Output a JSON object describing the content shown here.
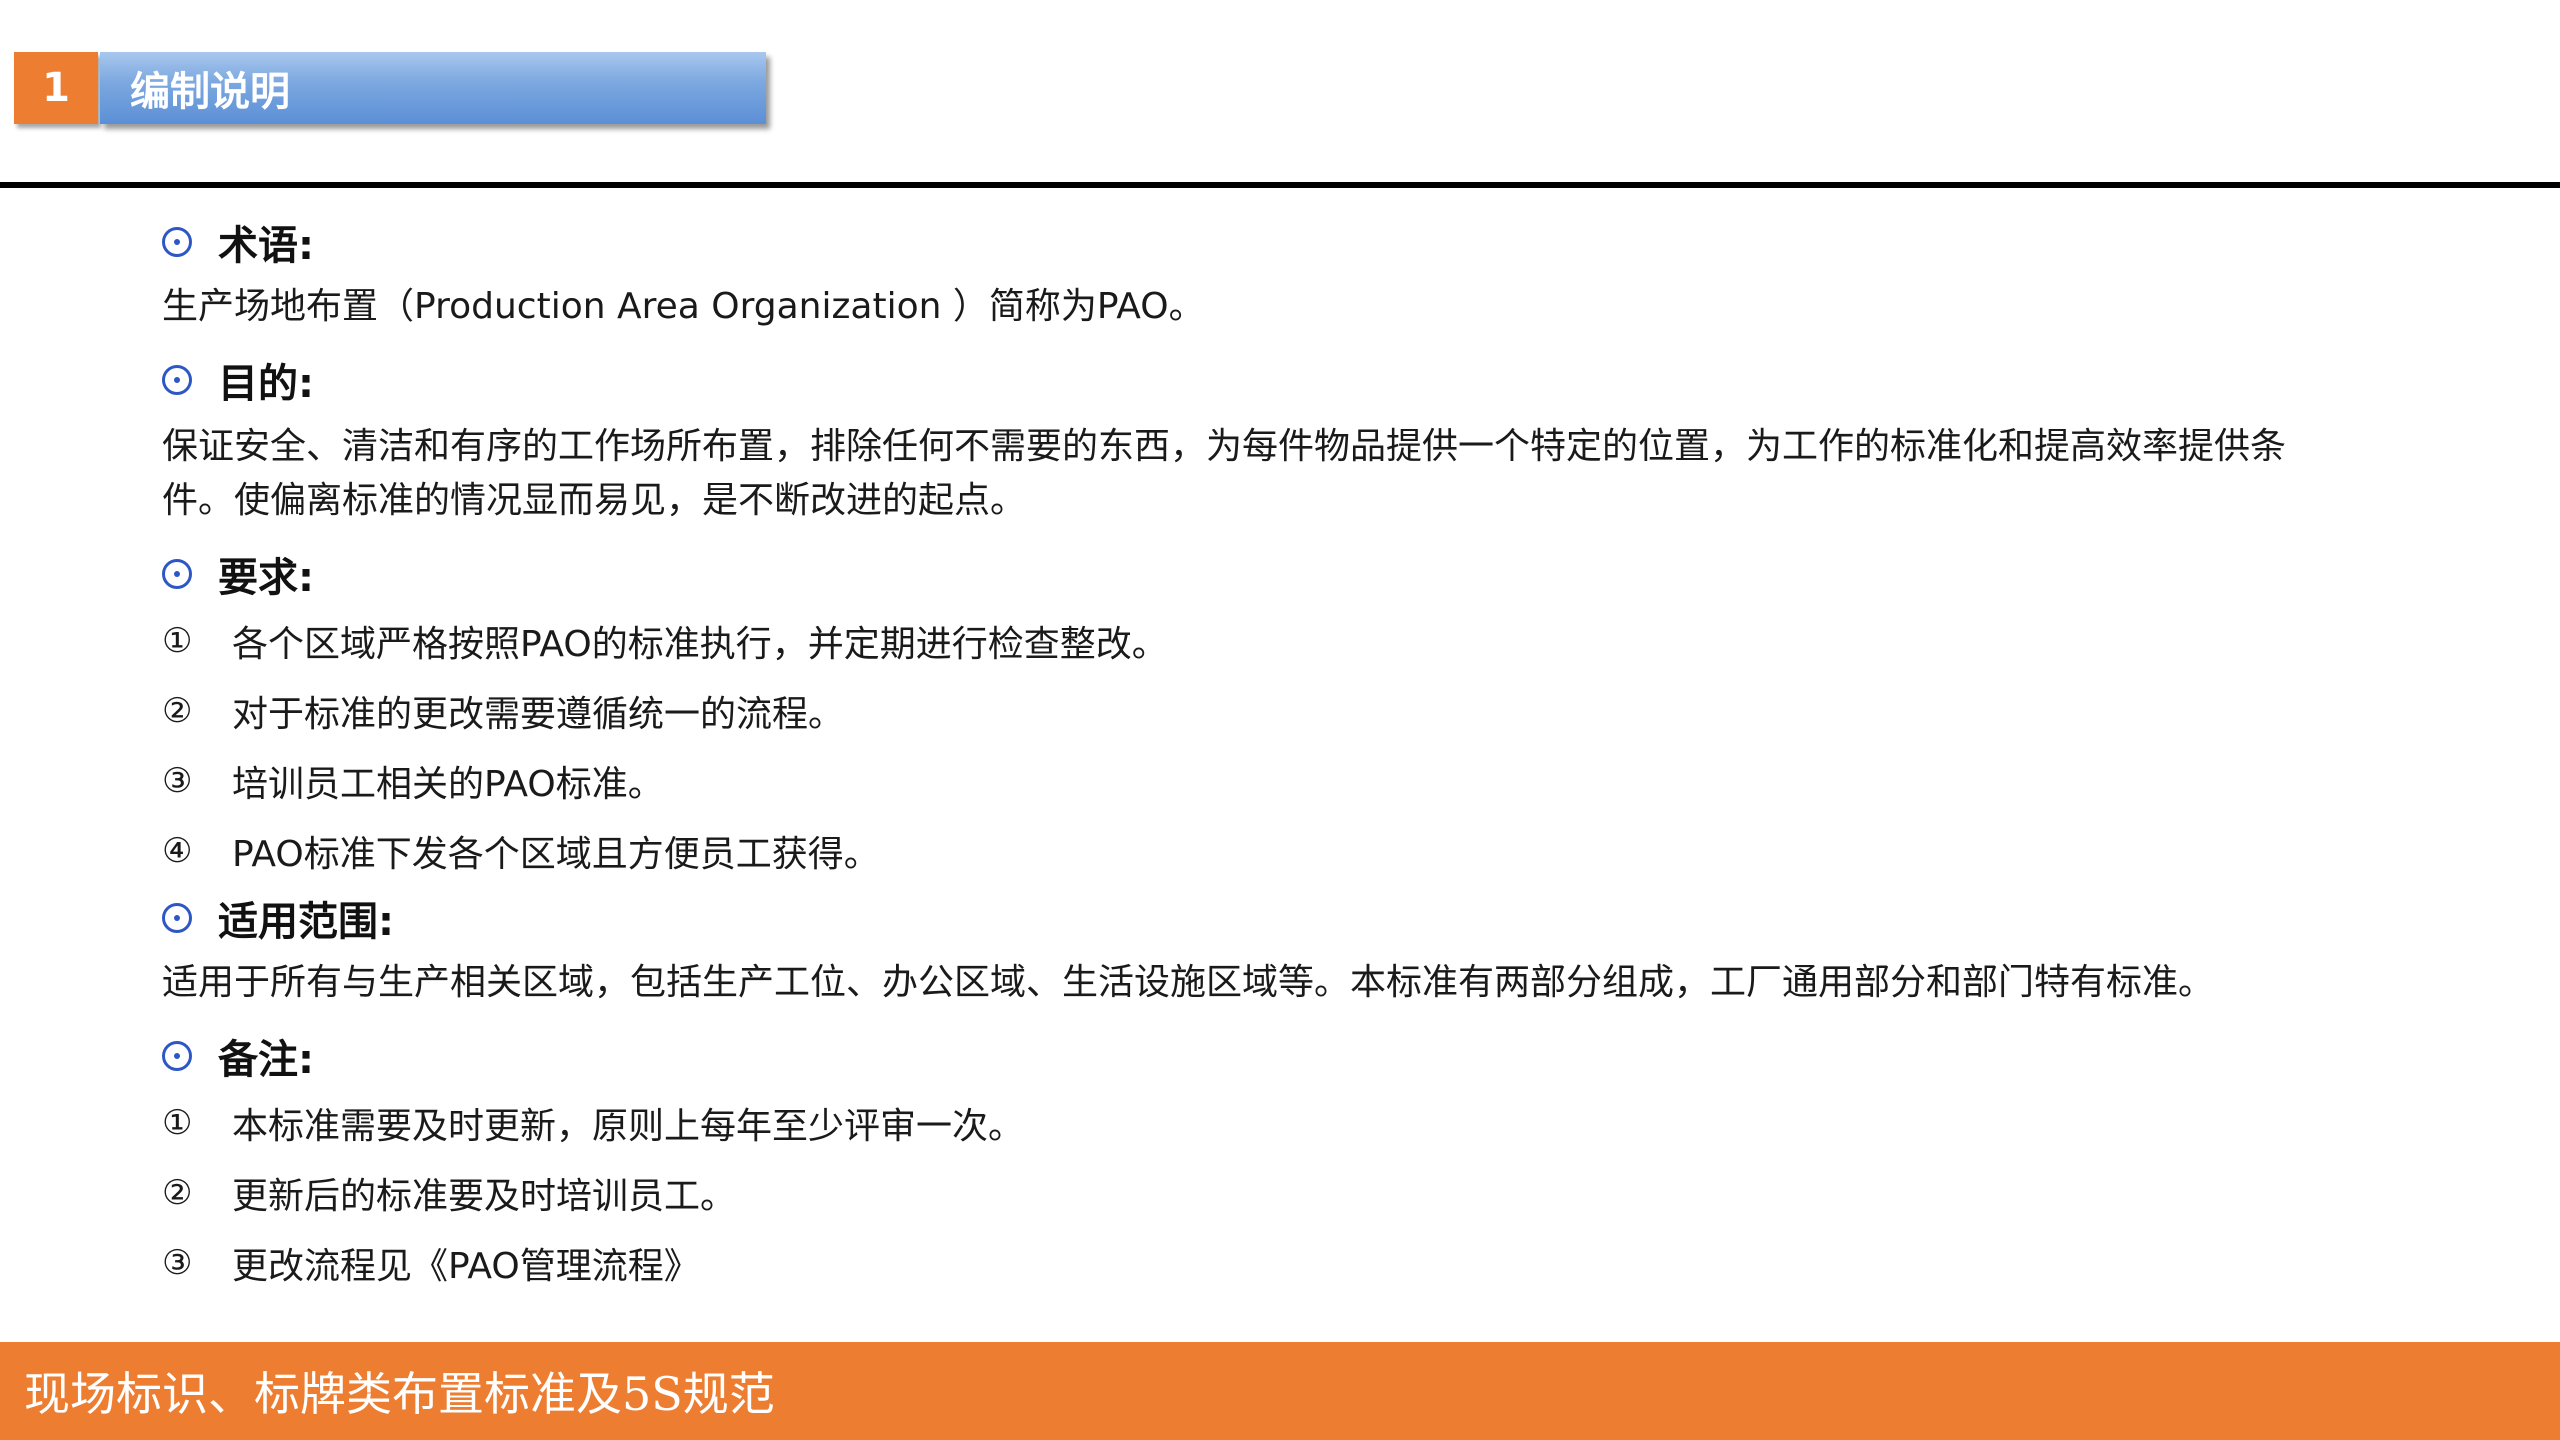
{
  "header": {
    "number": "1",
    "title": "编制说明"
  },
  "sections": {
    "terms": {
      "heading": "术语:",
      "text": "生产场地布置（Production Area Organization ）简称为PAO。"
    },
    "purpose": {
      "heading": "目的:",
      "lines": [
        "保证安全、清洁和有序的工作场所布置，排除任何不需要的东西，为每件物品提供一个特定的位置，为工作的标准化和提高效率提供条",
        "件。使偏离标准的情况显而易见，是不断改进的起点。"
      ]
    },
    "requirements": {
      "heading": "要求:",
      "items": [
        {
          "mark": "①",
          "text": "各个区域严格按照PAO的标准执行，并定期进行检查整改。"
        },
        {
          "mark": "②",
          "text": "对于标准的更改需要遵循统一的流程。"
        },
        {
          "mark": "③",
          "text": "培训员工相关的PAO标准。"
        },
        {
          "mark": "④",
          "text": "PAO标准下发各个区域且方便员工获得。"
        }
      ]
    },
    "scope": {
      "heading": "适用范围:",
      "text": "适用于所有与生产相关区域，包括生产工位、办公区域、生活设施区域等。本标准有两部分组成，工厂通用部分和部门特有标准。"
    },
    "notes": {
      "heading": "备注:",
      "items": [
        {
          "mark": "①",
          "text": "本标准需要及时更新，原则上每年至少评审一次。"
        },
        {
          "mark": "②",
          "text": "更新后的标准要及时培训员工。"
        },
        {
          "mark": "③",
          "text": "更改流程见《PAO管理流程》"
        }
      ]
    }
  },
  "footer": {
    "text": "现场标识、标牌类布置标准及5S规范"
  },
  "colors": {
    "accent": "#ED7D31",
    "header_blue": "#5B8FD6",
    "bullet_blue": "#2E57C6"
  }
}
